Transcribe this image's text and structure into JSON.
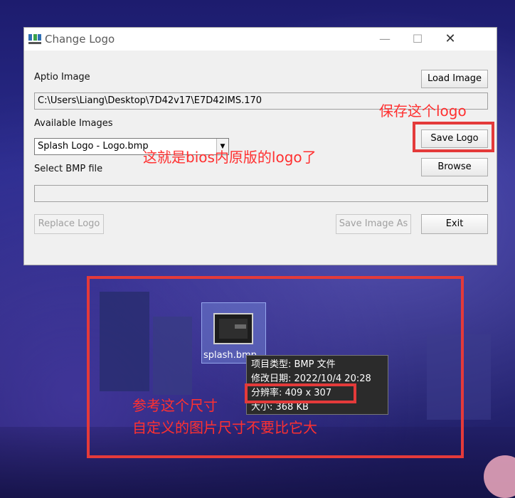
{
  "window": {
    "title": "Change Logo",
    "controls": {
      "minimize": "—",
      "maximize": "☐",
      "close": "✕"
    }
  },
  "aptio": {
    "label": "Aptio Image",
    "path": "C:\\Users\\Liang\\Desktop\\7D42v17\\E7D42IMS.170",
    "load_button": "Load Image"
  },
  "images": {
    "label": "Available Images",
    "selected": "Splash Logo - Logo.bmp",
    "save_button": "Save Logo",
    "browse_button": "Browse"
  },
  "bmp": {
    "label": "Select BMP file",
    "value": ""
  },
  "actions": {
    "replace": "Replace Logo",
    "save_image_as": "Save Image As",
    "exit": "Exit"
  },
  "annotations": {
    "save_note": "保存这个logo",
    "original_note": "这就是bios内原版的logo了",
    "size_note_1": "参考这个尺寸",
    "size_note_2": "自定义的图片尺寸不要比它大",
    "color": "#ff3030"
  },
  "desktop_file": {
    "name": "splash.bmp"
  },
  "tooltip": {
    "type": "项目类型: BMP 文件",
    "modified": "修改日期: 2022/10/4 20:28",
    "resolution": "分辨率: 409 x 307",
    "size": "大小: 368 KB"
  },
  "icons": {
    "app": "app-logo-icon",
    "dropdown": "chevron-down-icon"
  }
}
